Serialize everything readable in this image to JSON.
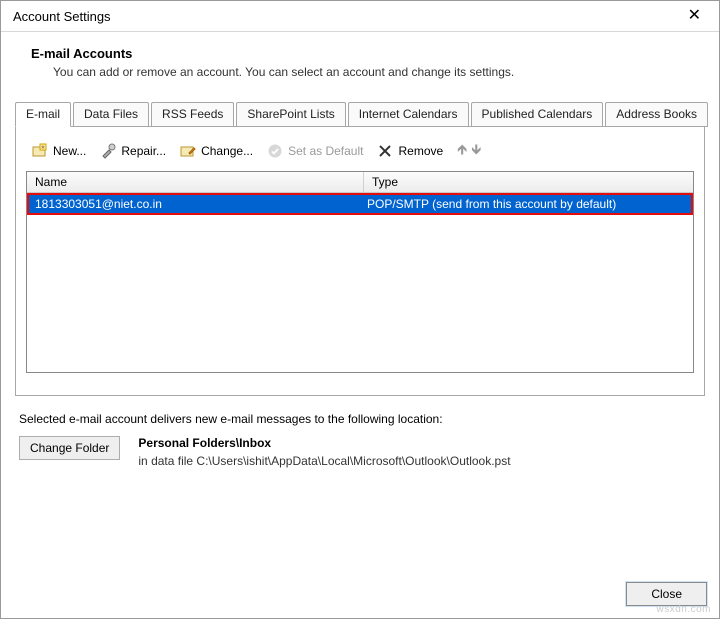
{
  "window": {
    "title": "Account Settings"
  },
  "header": {
    "title": "E-mail Accounts",
    "subtitle": "You can add or remove an account. You can select an account and change its settings."
  },
  "tabs": [
    {
      "label": "E-mail",
      "active": true
    },
    {
      "label": "Data Files"
    },
    {
      "label": "RSS Feeds"
    },
    {
      "label": "SharePoint Lists"
    },
    {
      "label": "Internet Calendars"
    },
    {
      "label": "Published Calendars"
    },
    {
      "label": "Address Books"
    }
  ],
  "toolbar": {
    "new_label": "New...",
    "repair_label": "Repair...",
    "change_label": "Change...",
    "set_default_label": "Set as Default",
    "remove_label": "Remove"
  },
  "columns": {
    "name": "Name",
    "type": "Type"
  },
  "accounts": [
    {
      "name": "1813303051@niet.co.in",
      "type": "POP/SMTP (send from this account by default)"
    }
  ],
  "delivery": {
    "intro": "Selected e-mail account delivers new e-mail messages to the following location:",
    "change_folder_label": "Change Folder",
    "folder_path": "Personal Folders\\Inbox",
    "datafile": "in data file C:\\Users\\ishit\\AppData\\Local\\Microsoft\\Outlook\\Outlook.pst"
  },
  "footer": {
    "close_label": "Close"
  },
  "watermark": "wsxdn.com"
}
